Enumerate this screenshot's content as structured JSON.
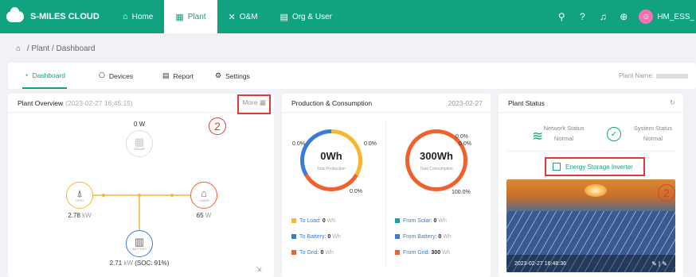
{
  "app": {
    "name": "S-MILES CLOUD"
  },
  "nav": [
    {
      "label": "Home",
      "icon": "home-icon"
    },
    {
      "label": "Plant",
      "icon": "plant-icon"
    },
    {
      "label": "O&M",
      "icon": "tools-icon"
    },
    {
      "label": "Org & User",
      "icon": "document-icon"
    }
  ],
  "user": {
    "name": "HM_ESS_"
  },
  "breadcrumb": {
    "items": [
      "Plant",
      "/",
      "Dashboard"
    ]
  },
  "tabs": [
    {
      "label": "Dashboard"
    },
    {
      "label": "Devices"
    },
    {
      "label": "Report"
    },
    {
      "label": "Settings"
    }
  ],
  "plant_name_label": "Plant Name:",
  "overview": {
    "title": "Plant Overview",
    "timestamp": "(2023-02-27 16:45:15)",
    "more_label": "More",
    "annotation": "2",
    "solar": {
      "value": "0",
      "unit": "W",
      "label": "SOLAR"
    },
    "grid": {
      "value": "2.78",
      "unit": "kW",
      "label": "GRID"
    },
    "loads": {
      "value": "65",
      "unit": "W",
      "label": "LOADS"
    },
    "battery": {
      "value": "2.71",
      "unit": "kW",
      "soc": "(SOC: 91%)",
      "label": "BATTERY"
    }
  },
  "production": {
    "title": "Production & Consumption",
    "date": "2023-02-27",
    "total_production": {
      "value": "0Wh",
      "label": "Total Production",
      "pct_left": "0.0%",
      "pct_right": "0.0%",
      "pct_bottom": "0.0%"
    },
    "total_consumption": {
      "value": "300Wh",
      "label": "Total Consumption",
      "pct_top1": "0.0%",
      "pct_top2": "0.0%",
      "pct_bottom": "100.0%"
    },
    "legend_left": [
      {
        "label": "To Load:",
        "value": "0",
        "unit": "Wh",
        "color": "#f5b731"
      },
      {
        "label": "To Battery:",
        "value": "0",
        "unit": "Wh",
        "color": "#3a7bd5"
      },
      {
        "label": "To Grid:",
        "value": "0",
        "unit": "Wh",
        "color": "#f0612e"
      }
    ],
    "legend_right": [
      {
        "label": "From Solar:",
        "value": "0",
        "unit": "Wh",
        "color": "#11a3a3"
      },
      {
        "label": "From Battery:",
        "value": "0",
        "unit": "Wh",
        "color": "#3a7bd5"
      },
      {
        "label": "From Grid:",
        "value": "300",
        "unit": "Wh",
        "color": "#f0612e"
      }
    ]
  },
  "status": {
    "title": "Plant Status",
    "network": {
      "label": "Network Status",
      "value": "Normal"
    },
    "system": {
      "label": "System Status",
      "value": "Normal"
    },
    "device_label": "Energy Storage Inverter",
    "annotation": "2",
    "photo_timestamp": "2023-02-27 16:48:36",
    "photo_tools": "✎ | ✎"
  },
  "colors": {
    "brand": "#11a37f",
    "grid": "#f5b731",
    "loads": "#f0612e",
    "battery": "#3a7bd5",
    "annotation": "#e53935"
  }
}
